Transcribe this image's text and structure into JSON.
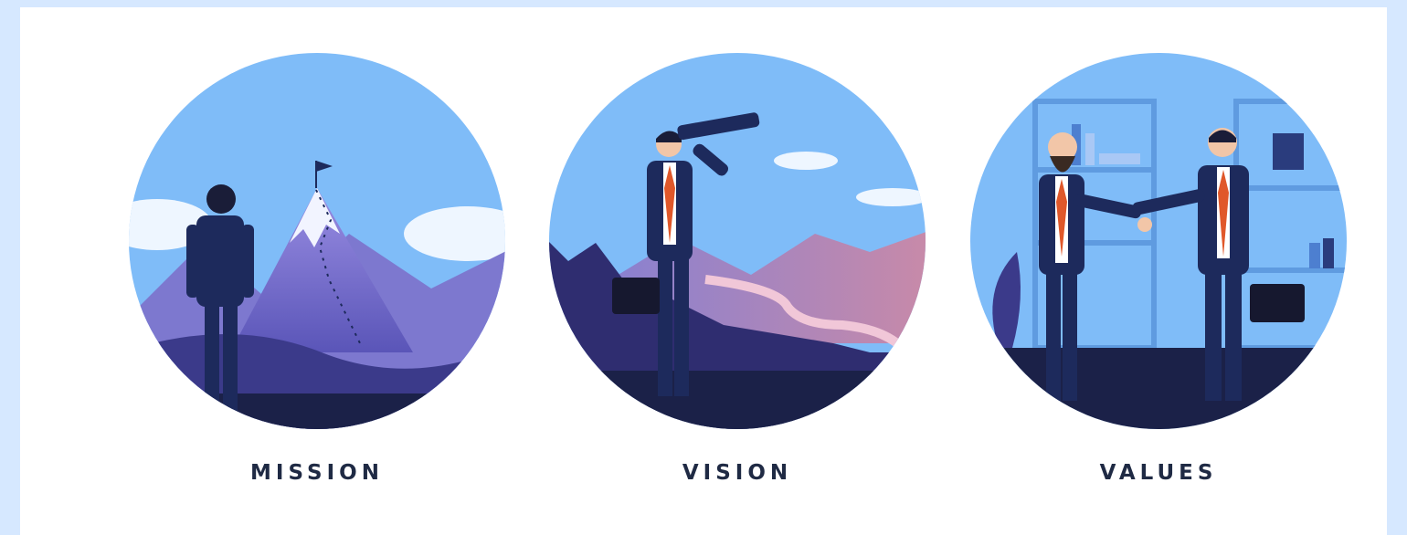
{
  "illustrations": [
    {
      "id": "mission",
      "caption": "MISSION",
      "scene": "businessman-looking-at-mountain-peak"
    },
    {
      "id": "vision",
      "caption": "VISION",
      "scene": "businessman-with-telescope"
    },
    {
      "id": "values",
      "caption": "VALUES",
      "scene": "businessmen-handshake"
    }
  ],
  "colors": {
    "sky": "#7fbcf8",
    "suit": "#1d2a5c",
    "tie": "#e0582a",
    "mountain": "#8b84d8",
    "snow": "#f2f4ff",
    "ground": "#1b2148"
  }
}
